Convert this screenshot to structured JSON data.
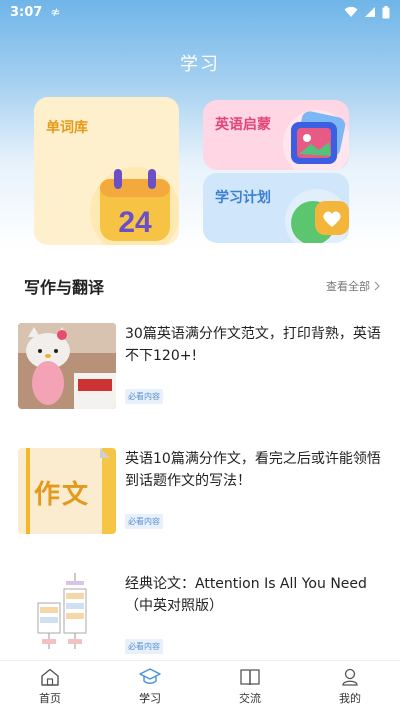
{
  "status_bar": {
    "time": "3:07",
    "extra": "≉"
  },
  "header": {
    "title": "学习"
  },
  "cards": {
    "vocab": {
      "label": "单词库",
      "badge_number": "24"
    },
    "enlight": {
      "label": "英语启蒙"
    },
    "plan": {
      "label": "学习计划"
    }
  },
  "section": {
    "title": "写作与翻译",
    "see_all": "查看全部"
  },
  "articles": [
    {
      "title": "30篇英语满分作文范文，打印背熟，英语不下120+!",
      "tag": "必看内容"
    },
    {
      "title": "英语10篇满分作文，看完之后或许能领悟到话题作文的写法！",
      "tag": "必看内容",
      "thumb_text": "作文"
    },
    {
      "title": "经典论文：Attention Is All You Need（中英对照版）",
      "tag": "必看内容"
    }
  ],
  "bottom_nav": [
    {
      "label": "首页",
      "icon": "home-icon"
    },
    {
      "label": "学习",
      "icon": "graduation-cap-icon",
      "active": true
    },
    {
      "label": "交流",
      "icon": "book-icon"
    },
    {
      "label": "我的",
      "icon": "user-icon"
    }
  ],
  "colors": {
    "header_top": "#6fb5e8",
    "vocab_card": "#fff0cd",
    "enlight_card": "#ffd6e4",
    "plan_card": "#cfe6fb",
    "tag_text": "#5b8ed1"
  }
}
